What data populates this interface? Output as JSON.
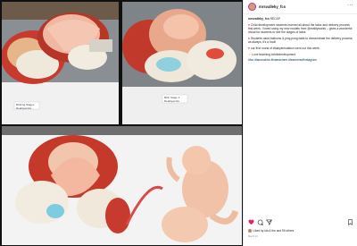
{
  "post": {
    "handle": "mrsvalleky_fcs",
    "caption_handle": "mrsvalleky_fcs",
    "recap": "RECAP",
    "paragraph1": "Child development students learned all about the labor and delivery process this week. I loved using my new models from @realityworks – gives a wonderful visual for students to see the stages of labor.",
    "paragraph2": "Students used balloons & ping pong balls to demonstrate the delivery process, as always, it's a hoot!",
    "paragraph3": "our first round of #babysimulation went out this week.",
    "paragraph4": "Love teaching #childdevelopment",
    "hashtags": "#fcs #facsrockhs #fcsteachers #teachersofinstagram",
    "liked_by": "Liked by ida & the and 59 others",
    "date": "March 16"
  },
  "model_labels": {
    "card1_line1": "Birthing Stages",
    "card1_line2": "Realityworks",
    "card2_line1": "Birth Stage 1",
    "card2_line2": "Realityworks"
  },
  "icons": {
    "like": "heart-icon",
    "comment": "comment-bubble-icon",
    "share": "paper-plane-icon",
    "save": "bookmark-icon",
    "more": "more-dots-icon"
  },
  "colors": {
    "link": "#00376b",
    "heart": "#e0245e",
    "text": "#262626",
    "muted": "#8e8e8e"
  }
}
